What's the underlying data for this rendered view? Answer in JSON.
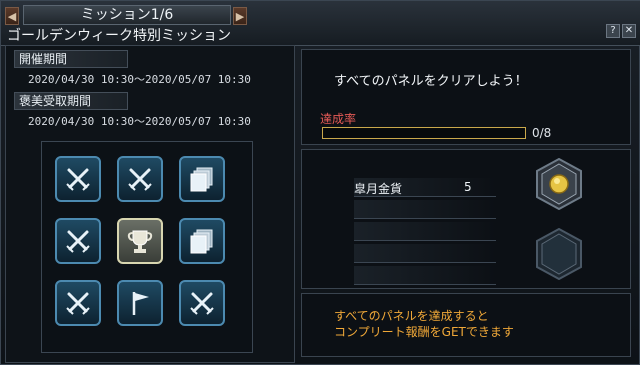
{
  "header": {
    "tab_title": "ミッション1/6",
    "subtitle": "ゴールデンウィーク特別ミッション",
    "prev_icon": "triangle-left",
    "next_icon": "triangle-right",
    "help_label": "?",
    "close_label": "✕"
  },
  "periods": {
    "event_label": "開催期間",
    "event_value": "2020/04/30 10:30〜2020/05/07 10:30",
    "reward_label": "褒美受取期間",
    "reward_value": "2020/04/30 10:30〜2020/05/07 10:30"
  },
  "grid": {
    "panels": [
      {
        "icon": "crossed-swords"
      },
      {
        "icon": "crossed-swords"
      },
      {
        "icon": "stacked-papers"
      },
      {
        "icon": "crossed-swords"
      },
      {
        "icon": "trophy",
        "selected": true
      },
      {
        "icon": "stacked-papers"
      },
      {
        "icon": "crossed-swords"
      },
      {
        "icon": "flag"
      },
      {
        "icon": "crossed-swords"
      }
    ]
  },
  "mission": {
    "description": "すべてのパネルをクリアしよう！",
    "rate_label": "達成率",
    "progress_text": "0/8",
    "progress_fraction": 0,
    "progress_color": "#c9a84b"
  },
  "rewards": {
    "items": [
      {
        "name": "皐月金貨",
        "count": "5"
      }
    ],
    "coin_icon": "gold-coin"
  },
  "footer": {
    "line1": "すべてのパネルを達成すると",
    "line2": "コンプリート報酬をGETできます"
  }
}
